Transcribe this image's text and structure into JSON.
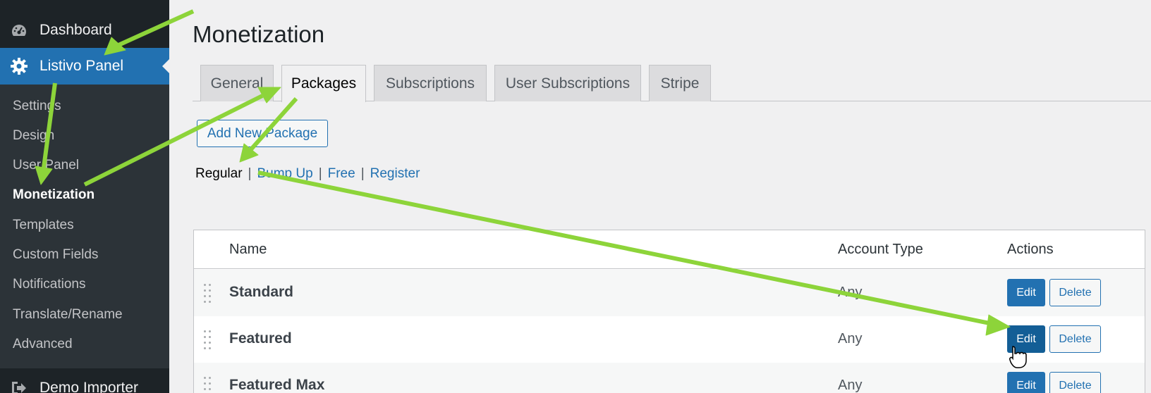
{
  "sidebar": {
    "dashboard_label": "Dashboard",
    "panel_label": "Listivo Panel",
    "submenu": [
      "Settings",
      "Design",
      "User Panel",
      "Monetization",
      "Templates",
      "Custom Fields",
      "Notifications",
      "Translate/Rename",
      "Advanced"
    ],
    "current_item": "Monetization",
    "demo_label": "Demo Importer"
  },
  "page": {
    "title": "Monetization"
  },
  "tabs": [
    "General",
    "Packages",
    "Subscriptions",
    "User Subscriptions",
    "Stripe"
  ],
  "active_tab": "Packages",
  "actions": {
    "add_package": "Add New Package"
  },
  "filters": {
    "current": "Regular",
    "links": [
      "Bump Up",
      "Free",
      "Register"
    ],
    "separator": "|"
  },
  "table": {
    "headers": {
      "name": "Name",
      "account_type": "Account Type",
      "actions": "Actions"
    },
    "rows": [
      {
        "name": "Standard",
        "account_type": "Any",
        "edit": "Edit",
        "delete": "Delete"
      },
      {
        "name": "Featured",
        "account_type": "Any",
        "edit": "Edit",
        "delete": "Delete"
      },
      {
        "name": "Featured Max",
        "account_type": "Any",
        "edit": "Edit",
        "delete": "Delete"
      }
    ]
  },
  "colors": {
    "accent": "#2271b1",
    "sidebar_bg": "#1d2327",
    "submenu_bg": "#2c3338",
    "annotation_arrow": "#8dd43a"
  },
  "icons": [
    "dashboard-icon",
    "gear-icon",
    "drag-handle-icon",
    "demo-importer-icon",
    "hand-cursor-icon"
  ]
}
